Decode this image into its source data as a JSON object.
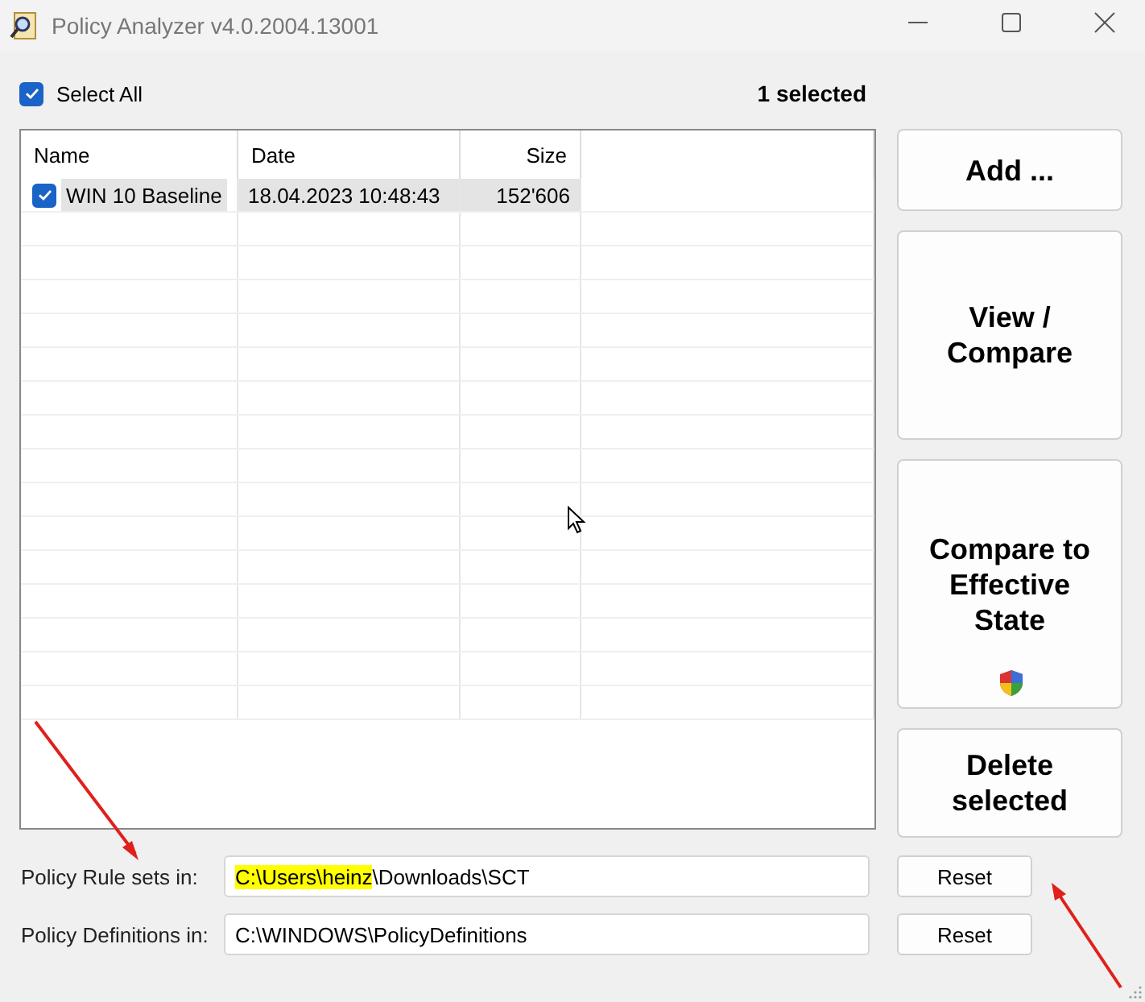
{
  "window": {
    "title": "Policy Analyzer v4.0.2004.13001"
  },
  "select_all": {
    "label": "Select All",
    "checked": true
  },
  "selection_count": "1 selected",
  "table": {
    "columns": [
      "Name",
      "Date",
      "Size"
    ],
    "rows": [
      {
        "name": "WIN 10 Baseline",
        "date": "18.04.2023 10:48:43",
        "size": "152'606",
        "checked": true,
        "selected": true
      }
    ]
  },
  "buttons": [
    {
      "label": "Add ...",
      "kind": "plain"
    },
    {
      "label": "View / Compare",
      "kind": "plain"
    },
    {
      "label": "Compare to Effective State",
      "kind": "shield"
    },
    {
      "label": "Delete selected",
      "kind": "plain"
    }
  ],
  "paths": [
    {
      "label": "Policy Rule sets in:",
      "value_parts": [
        {
          "text": "C:\\Users\\heinz",
          "highlighted": true
        },
        {
          "text": "\\Downloads\\SCT",
          "highlighted": false
        }
      ],
      "button": "Reset"
    },
    {
      "label": "Policy Definitions in:",
      "value_parts": [
        {
          "text": "C:\\WINDOWS\\PolicyDefinitions",
          "highlighted": false
        }
      ],
      "button": "Reset"
    }
  ]
}
